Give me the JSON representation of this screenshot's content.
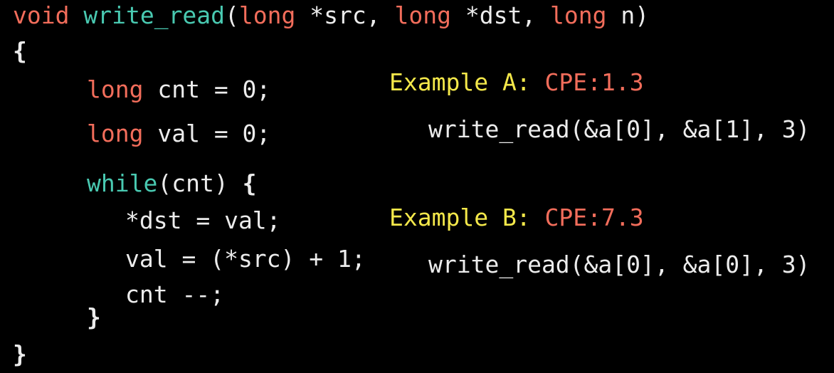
{
  "code": {
    "signature": {
      "ret_type": "void",
      "func_name": "write_read",
      "open_paren": "(",
      "param1_type": "long",
      "param1_name": " *src, ",
      "param2_type": "long",
      "param2_name": " *dst, ",
      "param3_type": "long",
      "param3_name": " n",
      "close_paren": ")"
    },
    "open_brace": "{",
    "decl_cnt_type": "long",
    "decl_cnt_rest": " cnt = 0;",
    "decl_val_type": "long",
    "decl_val_rest": " val = 0;",
    "while_kw": "while",
    "while_cond": "(cnt) ",
    "while_brace": "{",
    "stmt1": "*dst = val;",
    "stmt2": "val = (*src) + 1;",
    "stmt3": "cnt --;",
    "inner_close_brace": "}",
    "outer_close_brace": "}"
  },
  "examples": [
    {
      "label": "Example A: ",
      "cpe": "CPE:1.3",
      "call": "write_read(&a[0], &a[1], 3)"
    },
    {
      "label": "Example B: ",
      "cpe": "CPE:7.3",
      "call": "write_read(&a[0], &a[0], 3)"
    }
  ],
  "colors": {
    "background": "#000000",
    "keyword_red": "#f26d5b",
    "keyword_teal": "#49c9b1",
    "text": "#ececec",
    "example_label": "#f4e84a",
    "cpe": "#f26d5b"
  }
}
